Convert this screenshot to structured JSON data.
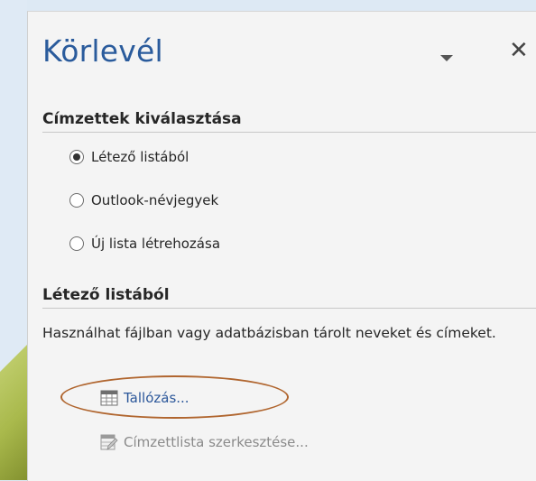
{
  "pane": {
    "title": "Körlevél"
  },
  "recipients_section": {
    "heading": "Címzettek kiválasztása",
    "options": [
      {
        "label": "Létező listából",
        "selected": true
      },
      {
        "label": "Outlook-névjegyek",
        "selected": false
      },
      {
        "label": "Új lista létrehozása",
        "selected": false
      }
    ]
  },
  "existing_list_section": {
    "heading": "Létező listából",
    "description": "Használhat fájlban vagy adatbázisban tárolt neveket és címeket.",
    "browse_label": "Tallózás...",
    "edit_list_label": "Címzettlista szerkesztése..."
  },
  "colors": {
    "title_blue": "#2a5b9c",
    "link_blue": "#2b579a",
    "highlight_ellipse": "#b0652e",
    "disabled_text": "#8a8a8a"
  },
  "icons": {
    "menu": "chevron-down-icon",
    "close": "close-icon",
    "browse": "table-icon",
    "edit_list": "edit-list-icon"
  }
}
